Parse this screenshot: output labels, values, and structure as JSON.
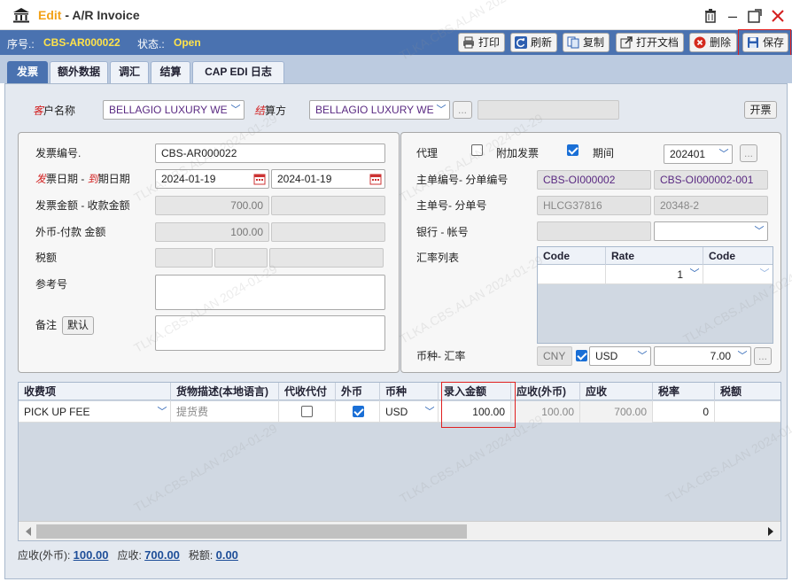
{
  "window": {
    "edit_label": "Edit",
    "title_sep": " - ",
    "title": "A/R Invoice"
  },
  "info": {
    "seq_label": "序号.:",
    "seq_value": "CBS-AR000022",
    "status_label": "状态.:",
    "status_value": "Open"
  },
  "toolbar": {
    "print": "打印",
    "refresh": "刷新",
    "copy": "复制",
    "open_doc": "打开文档",
    "delete": "删除",
    "save": "保存"
  },
  "tabs": [
    "发票",
    "额外数据",
    "调汇",
    "结算",
    "CAP EDI 日志"
  ],
  "top": {
    "customer_label_red": "客",
    "customer_label": "户名称",
    "customer_value": "BELLAGIO LUXURY WE",
    "settle_label_red": "结",
    "settle_label": "算方",
    "settle_value": "BELLAGIO LUXURY WE",
    "ellipsis": "...",
    "invoice_button": "开票"
  },
  "left": {
    "invoice_no_label": "发票编号.",
    "invoice_no_value": "CBS-AR000022",
    "date_label_red1": "发",
    "date_label_mid": "票日期 - ",
    "date_label_red2": "到",
    "date_label_end": "期日期",
    "invoice_date": "2024-01-19",
    "due_date": "2024-01-19",
    "amount_label": "发票金额 - 收款金额",
    "amount_value": "700.00",
    "fx_label": "外币-付款 金额",
    "fx_value": "100.00",
    "tax_label": "税额",
    "ref_label": "参考号",
    "remark_label": "备注",
    "default_button": "默认"
  },
  "right": {
    "agent_label": "代理",
    "extra_invoice_label": "附加发票",
    "period_label": "期间",
    "period_value": "202401",
    "main_no_label": "主单编号- 分单编号",
    "main_no_value": "CBS-OI000002",
    "sub_no_value": "CBS-OI000002-001",
    "master_label": "主单号- 分单号",
    "master_value": "HLCG37816",
    "house_value": "20348-2",
    "bank_label": "银行 - 帐号",
    "rate_list_label": "汇率列表",
    "rate_headers": [
      "Code",
      "Rate",
      "Code"
    ],
    "rate_row_value": "1",
    "currency_label": "币种- 汇率",
    "currency_base": "CNY",
    "currency_value": "USD",
    "exchange_rate": "7.00"
  },
  "charges": {
    "headers": [
      "收费项",
      "货物描述(本地语言)",
      "代收代付",
      "外币",
      "币种",
      "录入金额",
      "应收(外币)",
      "应收",
      "税率",
      "税额"
    ],
    "rows": [
      {
        "item": "PICK UP FEE",
        "desc": "提货费",
        "collect": false,
        "foreign": true,
        "currency": "USD",
        "amount": "100.00",
        "ar_fx": "100.00",
        "ar": "700.00",
        "tax_rate": "0",
        "tax": ""
      }
    ]
  },
  "footer": {
    "ar_fx_label": "应收(外币):",
    "ar_fx_value": "100.00",
    "ar_label": "应收:",
    "ar_value": "700.00",
    "tax_label": "税额:",
    "tax_value": "0.00"
  },
  "watermark": "TLKA.CBS.ALAN 2024-01-29"
}
